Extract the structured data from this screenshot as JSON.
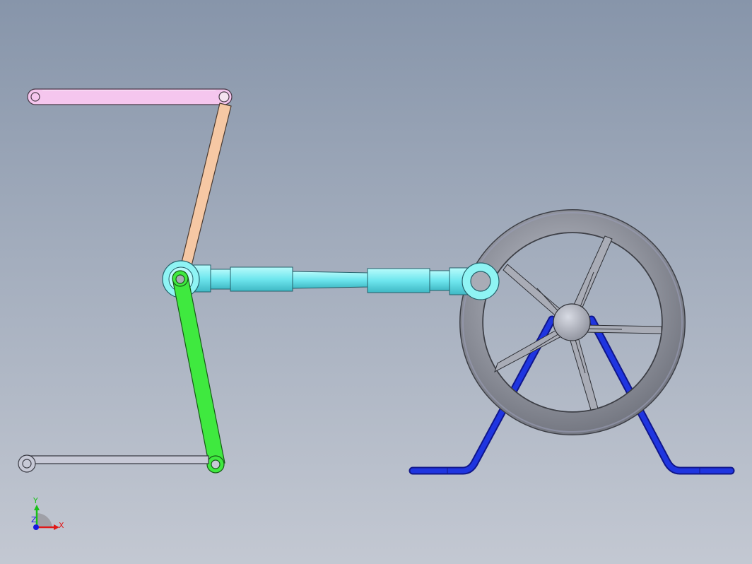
{
  "view": {
    "background_top": "#8795aa",
    "background_bottom": "#c3c8d2"
  },
  "parts": [
    {
      "id": "top-link",
      "color": "#f5c6ee"
    },
    {
      "id": "upper-rocker",
      "color": "#f6c8a4"
    },
    {
      "id": "connecting-rod",
      "color": "#7ff1f1"
    },
    {
      "id": "lower-rocker",
      "color": "#3fe93f"
    },
    {
      "id": "bottom-link",
      "color": "#c7c9d6"
    },
    {
      "id": "handwheel",
      "color": "#8a8d96"
    },
    {
      "id": "stand",
      "color": "#1d2bd6"
    }
  ],
  "triad": {
    "x_label": "X",
    "y_label": "Y",
    "z_label": "Z",
    "x_color": "#e01818",
    "y_color": "#18c018",
    "z_color": "#1818e0"
  }
}
